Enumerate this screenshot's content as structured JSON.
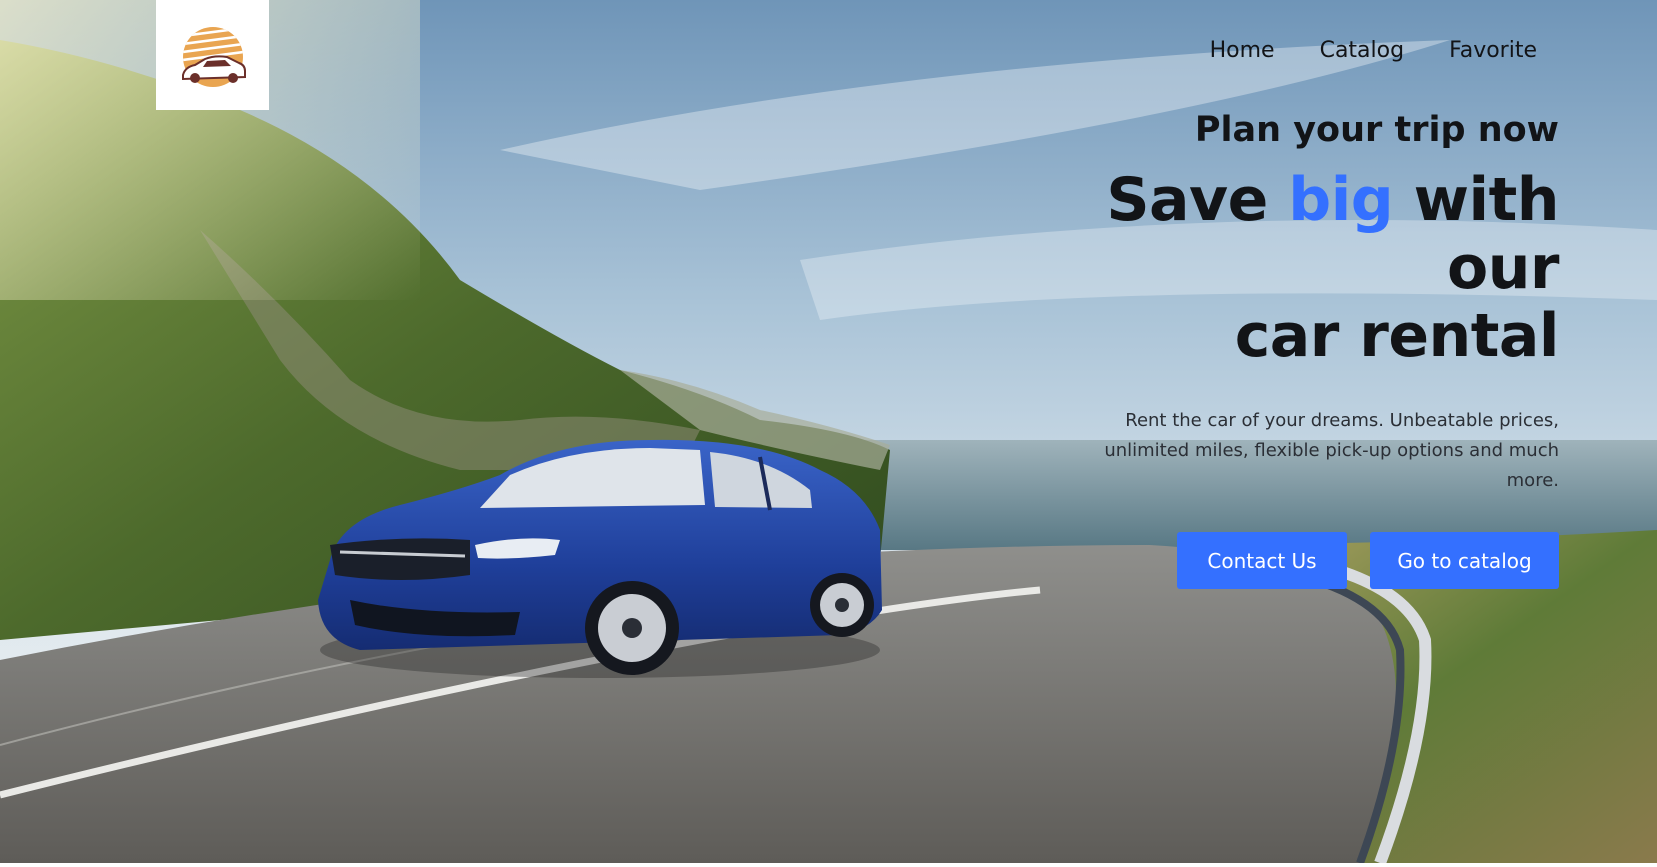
{
  "brand": {
    "logo_icon": "car-sun-logo-icon"
  },
  "nav": {
    "items": [
      {
        "label": "Home"
      },
      {
        "label": "Catalog"
      },
      {
        "label": "Favorite"
      }
    ]
  },
  "hero": {
    "subtitle": "Plan your trip now",
    "title_prefix": "Save ",
    "title_accent": "big",
    "title_suffix_line1": " with our",
    "title_line2": "car rental",
    "description": "Rent the car of your dreams. Unbeatable prices, unlimited miles, flexible pick-up options and much more.",
    "primary_button": "Contact Us",
    "secondary_button": "Go to catalog"
  },
  "colors": {
    "accent": "#3470ff",
    "text": "#121417",
    "button_text": "#ffffff"
  }
}
